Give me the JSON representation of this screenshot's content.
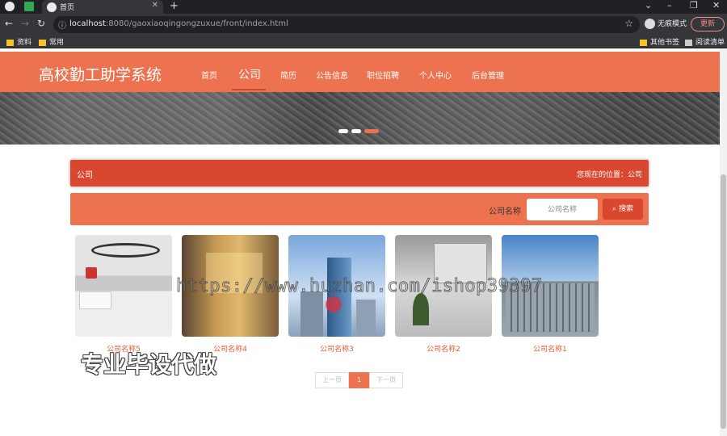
{
  "browser": {
    "tab_title": "首页",
    "url_host": "localhost",
    "url_rest": ":8080/gaoxiaoqingongzuxue/front/index.html",
    "incognito_label": "无痕模式",
    "update_label": "更新",
    "bookmarks": [
      "资料",
      "常用"
    ],
    "bookmarks_right": [
      "其他书签",
      "阅读清单"
    ]
  },
  "site": {
    "brand": "高校勤工助学系统",
    "nav": [
      "首页",
      "公司",
      "简历",
      "公告信息",
      "职位招聘",
      "个人中心",
      "后台管理"
    ],
    "active_nav": "公司"
  },
  "breadcrumb": {
    "title": "公司",
    "location": "您现在的位置：公司"
  },
  "search": {
    "label": "公司名称",
    "placeholder": "公司名称",
    "button": "搜索"
  },
  "companies": [
    {
      "name": "公司名称5"
    },
    {
      "name": "公司名称4"
    },
    {
      "name": "公司名称3"
    },
    {
      "name": "公司名称2"
    },
    {
      "name": "公司名称1"
    }
  ],
  "pagination": {
    "prev": "上一页",
    "current": "1",
    "next": "下一页"
  },
  "overlay": {
    "watermark": "https://www.huzhan.com/ishop39397",
    "ad_text": "专业毕设代做"
  },
  "colors": {
    "accent": "#ed7350",
    "accent_dark": "#d9472f"
  }
}
